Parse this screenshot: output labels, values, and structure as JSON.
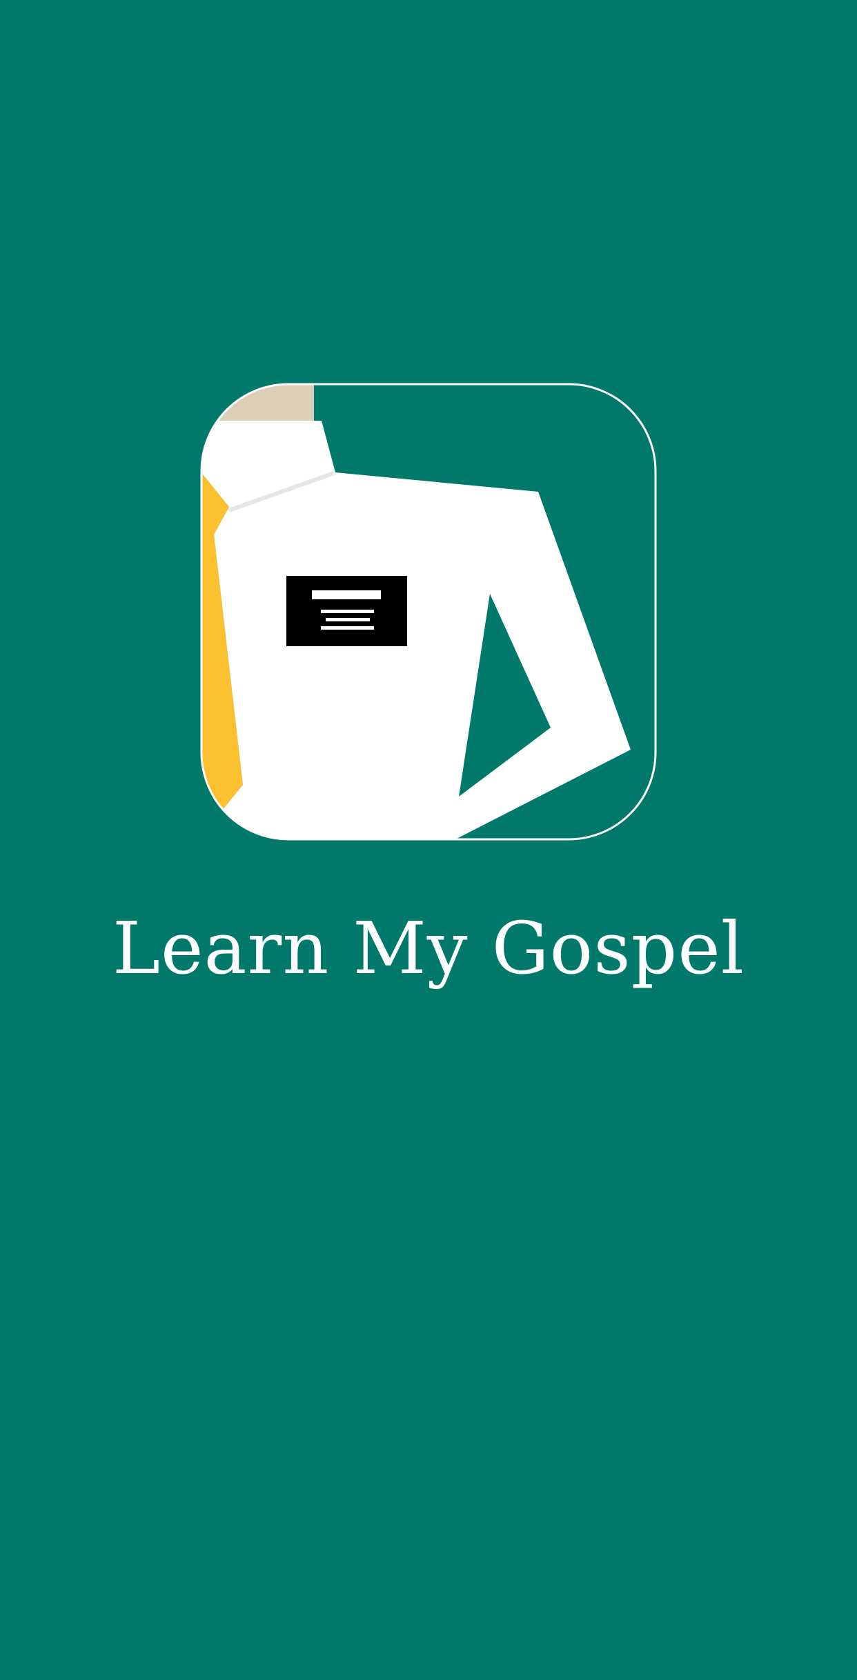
{
  "app": {
    "title": "Learn My Gospel",
    "logo_icon": "missionary-figure-icon"
  },
  "colors": {
    "background": "#00796b",
    "title_text": "#ffffff",
    "shirt": "#ffffff",
    "tie": "#fbc02d",
    "skin": "#dccdb6",
    "name_tag": "#000000"
  }
}
